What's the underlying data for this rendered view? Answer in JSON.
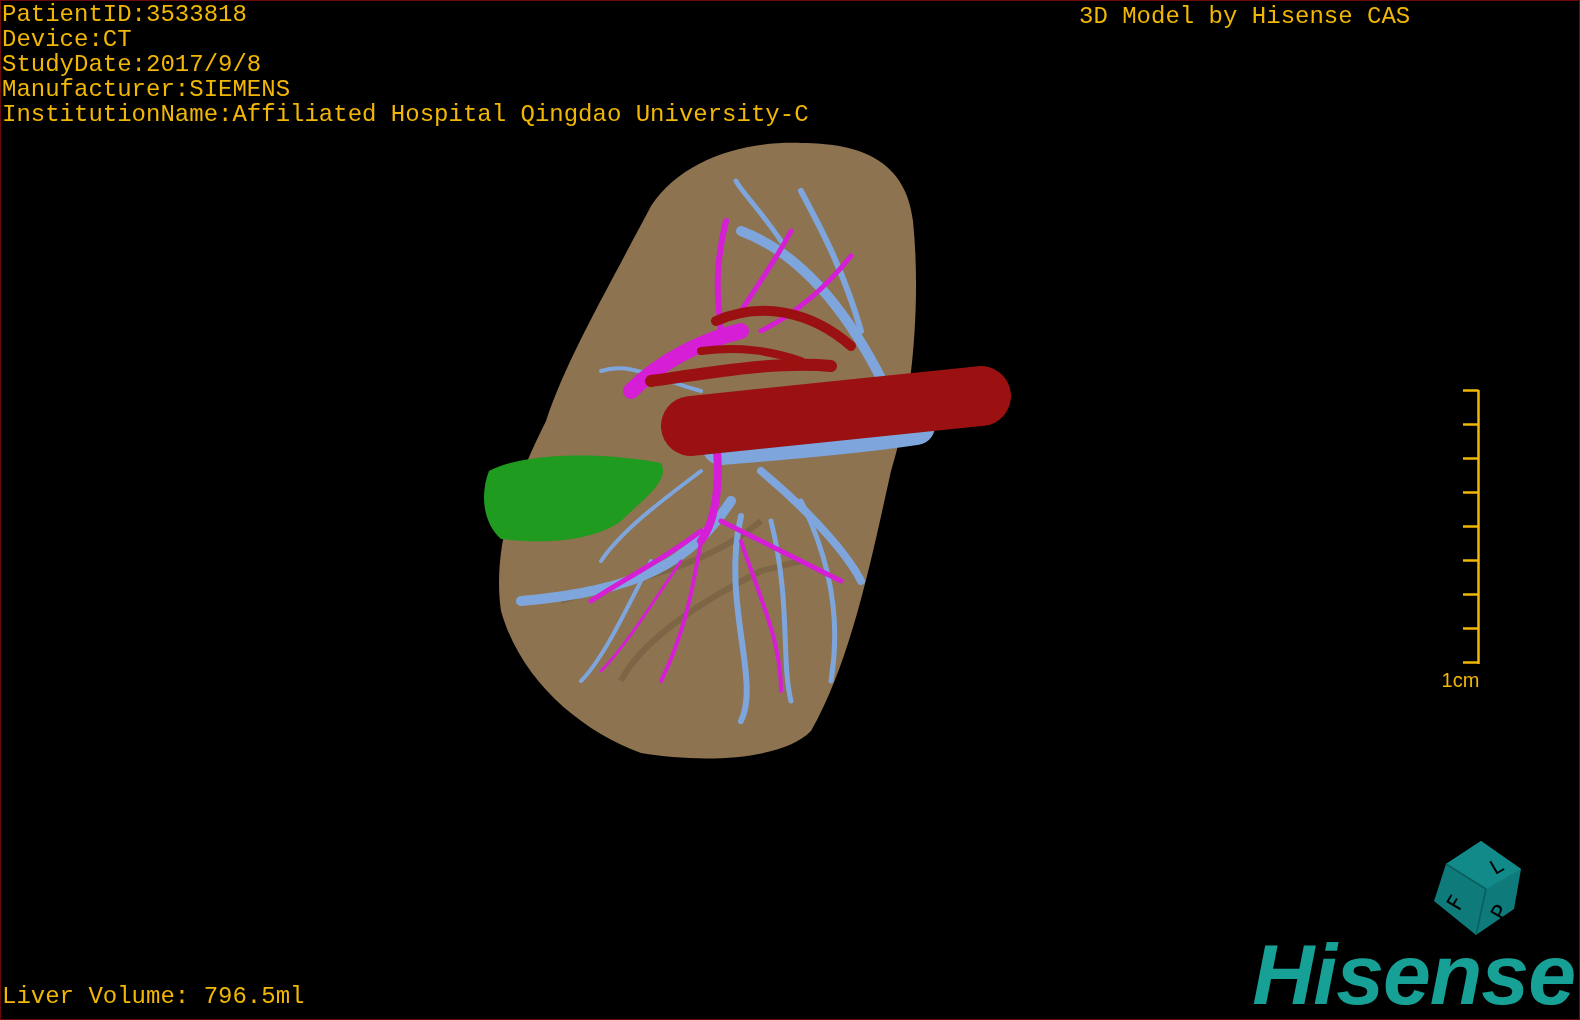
{
  "patient_info": [
    "PatientID:3533818",
    "Device:CT",
    "StudyDate:2017/9/8",
    "Manufacturer:SIEMENS",
    "InstitutionName:Affiliated Hospital Qingdao University-C"
  ],
  "caption": "3D Model by Hisense CAS",
  "scale_bar": {
    "label": "1cm"
  },
  "orientation_cube": {
    "labels": [
      "F",
      "L",
      "P"
    ]
  },
  "logo": "Hisense",
  "status": "Liver Volume: 796.5ml"
}
